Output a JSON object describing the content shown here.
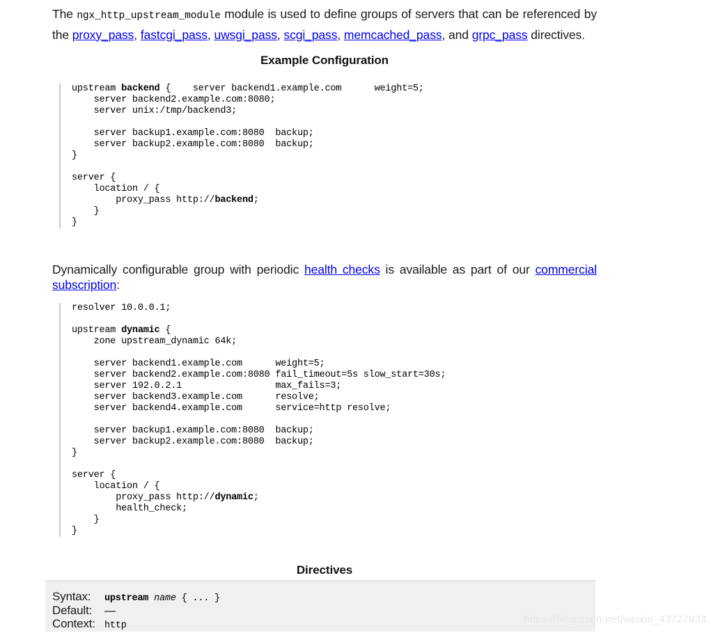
{
  "intro": {
    "before_code": "The ",
    "module_name": "ngx_http_upstream_module",
    "after_code": " module is used to define groups of servers that can be referenced by the ",
    "links": [
      {
        "label": "proxy_pass",
        "sep": ", "
      },
      {
        "label": "fastcgi_pass",
        "sep": ", "
      },
      {
        "label": "uwsgi_pass",
        "sep": ", "
      },
      {
        "label": "scgi_pass",
        "sep": ", "
      },
      {
        "label": "memcached_pass",
        "sep": ", and "
      },
      {
        "label": "grpc_pass",
        "sep": ""
      }
    ],
    "tail": " directives."
  },
  "headings": {
    "example_configuration": "Example Configuration",
    "directives": "Directives"
  },
  "code_example": {
    "line1_pre": "upstream ",
    "line1_bold": "backend",
    "line1_post": " {",
    "body_a": "    server backend1.example.com      weight=5;\n    server backend2.example.com:8080;\n    server unix:/tmp/backend3;\n\n    server backup1.example.com:8080  backup;\n    server backup2.example.com:8080  backup;\n}\n\nserver {\n    location / {\n        proxy_pass http://",
    "inner_bold": "backend",
    "body_b": ";\n    }\n}"
  },
  "para_dynamic": {
    "lead": "Dynamically configurable group with periodic ",
    "link_health": "health checks",
    "middle": " is available as part of our ",
    "link_commercial": "commercial subscription",
    "tail": ":"
  },
  "code_dynamic": {
    "head": "resolver 10.0.0.1;\n\nupstream ",
    "name_bold": "dynamic",
    "body_a": " {\n    zone upstream_dynamic 64k;\n\n    server backend1.example.com      weight=5;\n    server backend2.example.com:8080 fail_timeout=5s slow_start=30s;\n    server 192.0.2.1                 max_fails=3;\n    server backend3.example.com      resolve;\n    server backend4.example.com      service=http resolve;\n\n    server backup1.example.com:8080  backup;\n    server backup2.example.com:8080  backup;\n}\n\nserver {\n    location / {\n        proxy_pass http://",
    "inner_bold": "dynamic",
    "body_b": ";\n        health_check;\n    }\n}"
  },
  "directive": {
    "rows": [
      {
        "label": "Syntax:"
      },
      {
        "label": "Default:"
      },
      {
        "label": "Context:"
      }
    ],
    "syntax_keyword": "upstream",
    "syntax_var": "name",
    "syntax_rest": " { ... }",
    "default_value": "—",
    "context_value": "http"
  },
  "watermark": {
    "text": "https://blog.csdn.net/weixin_43727933"
  },
  "colors": {
    "link": "#0000ee",
    "code_border": "#c9c9c9",
    "directive_bg": "#f0f0f0",
    "watermark": "#e6e6e6"
  }
}
